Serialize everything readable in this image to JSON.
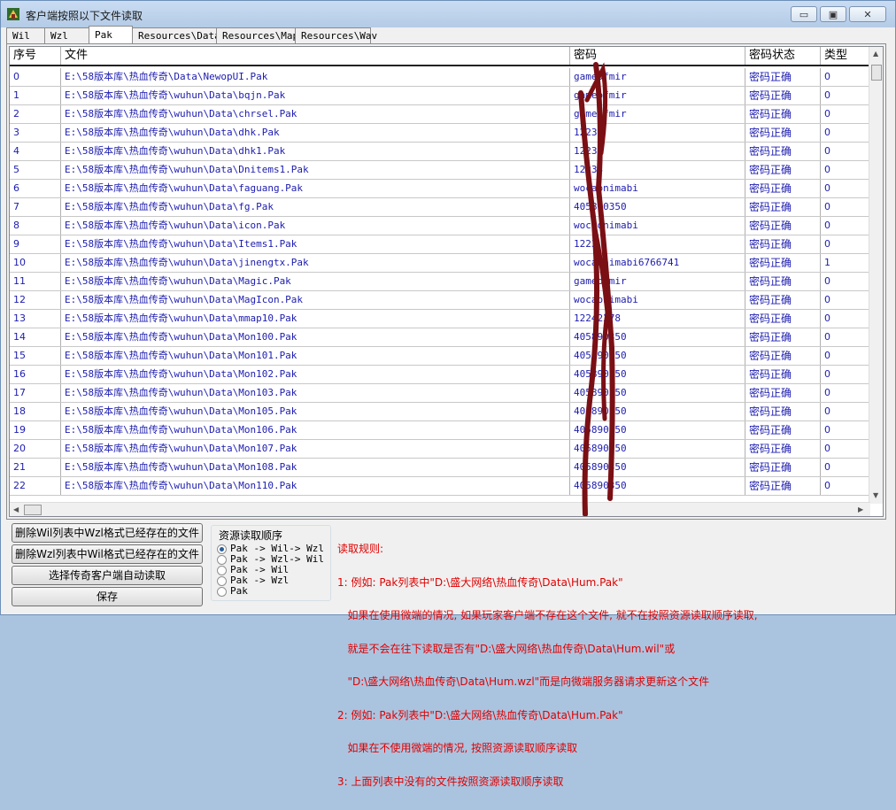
{
  "window": {
    "title": "客户端按照以下文件读取",
    "minimize_icon": "minimize-icon",
    "maximize_icon": "maximize-icon",
    "close_icon": "close-icon"
  },
  "tabs": [
    "Wil",
    "Wzl",
    "Pak",
    "Resources\\Data",
    "Resources\\Map",
    "Resources\\Wav"
  ],
  "active_tab": "Pak",
  "table": {
    "headers": [
      "序号",
      "文件",
      "密码",
      "密码状态",
      "类型"
    ],
    "rows": [
      [
        "0",
        "E:\\58版本库\\热血传奇\\Data\\NewopUI.Pak",
        "gameofmir",
        "密码正确",
        "0"
      ],
      [
        "1",
        "E:\\58版本库\\热血传奇\\wuhun\\Data\\bqjn.Pak",
        "gameofmir",
        "密码正确",
        "0"
      ],
      [
        "2",
        "E:\\58版本库\\热血传奇\\wuhun\\Data\\chrsel.Pak",
        "gameofmir",
        "密码正确",
        "0"
      ],
      [
        "3",
        "E:\\58版本库\\热血传奇\\wuhun\\Data\\dhk.Pak",
        "1223",
        "密码正确",
        "0"
      ],
      [
        "4",
        "E:\\58版本库\\热血传奇\\wuhun\\Data\\dhk1.Pak",
        "1223",
        "密码正确",
        "0"
      ],
      [
        "5",
        "E:\\58版本库\\热血传奇\\wuhun\\Data\\Dnitems1.Pak",
        "12233",
        "密码正确",
        "0"
      ],
      [
        "6",
        "E:\\58版本库\\热血传奇\\wuhun\\Data\\faguang.Pak",
        "wocaonimabi",
        "密码正确",
        "0"
      ],
      [
        "7",
        "E:\\58版本库\\热血传奇\\wuhun\\Data\\fg.Pak",
        "405890350",
        "密码正确",
        "0"
      ],
      [
        "8",
        "E:\\58版本库\\热血传奇\\wuhun\\Data\\icon.Pak",
        "wocaonimabi",
        "密码正确",
        "0"
      ],
      [
        "9",
        "E:\\58版本库\\热血传奇\\wuhun\\Data\\Items1.Pak",
        "1223",
        "密码正确",
        "0"
      ],
      [
        "10",
        "E:\\58版本库\\热血传奇\\wuhun\\Data\\jinengtx.Pak",
        "wocaonimabi6766741",
        "密码正确",
        "1"
      ],
      [
        "11",
        "E:\\58版本库\\热血传奇\\wuhun\\Data\\Magic.Pak",
        "gameofmir",
        "密码正确",
        "0"
      ],
      [
        "12",
        "E:\\58版本库\\热血传奇\\wuhun\\Data\\MagIcon.Pak",
        "wocaonimabi",
        "密码正确",
        "0"
      ],
      [
        "13",
        "E:\\58版本库\\热血传奇\\wuhun\\Data\\mmap10.Pak",
        "12242278",
        "密码正确",
        "0"
      ],
      [
        "14",
        "E:\\58版本库\\热血传奇\\wuhun\\Data\\Mon100.Pak",
        "405890350",
        "密码正确",
        "0"
      ],
      [
        "15",
        "E:\\58版本库\\热血传奇\\wuhun\\Data\\Mon101.Pak",
        "405890350",
        "密码正确",
        "0"
      ],
      [
        "16",
        "E:\\58版本库\\热血传奇\\wuhun\\Data\\Mon102.Pak",
        "405890350",
        "密码正确",
        "0"
      ],
      [
        "17",
        "E:\\58版本库\\热血传奇\\wuhun\\Data\\Mon103.Pak",
        "405890350",
        "密码正确",
        "0"
      ],
      [
        "18",
        "E:\\58版本库\\热血传奇\\wuhun\\Data\\Mon105.Pak",
        "405890350",
        "密码正确",
        "0"
      ],
      [
        "19",
        "E:\\58版本库\\热血传奇\\wuhun\\Data\\Mon106.Pak",
        "405890350",
        "密码正确",
        "0"
      ],
      [
        "20",
        "E:\\58版本库\\热血传奇\\wuhun\\Data\\Mon107.Pak",
        "405890350",
        "密码正确",
        "0"
      ],
      [
        "21",
        "E:\\58版本库\\热血传奇\\wuhun\\Data\\Mon108.Pak",
        "405890350",
        "密码正确",
        "0"
      ],
      [
        "22",
        "E:\\58版本库\\热血传奇\\wuhun\\Data\\Mon110.Pak",
        "405890350",
        "密码正确",
        "0"
      ]
    ]
  },
  "buttons": {
    "delete_wil": "删除Wil列表中Wzl格式已经存在的文件",
    "delete_wzl": "删除Wzl列表中Wil格式已经存在的文件",
    "auto_read": "选择传奇客户端自动读取",
    "save": "保存"
  },
  "resource_order": {
    "title": "资源读取顺序",
    "options": [
      "Pak -> Wil-> Wzl",
      "Pak -> Wzl-> Wil",
      "Pak -> Wil",
      "Pak -> Wzl",
      "Pak"
    ],
    "selected_index": 0
  },
  "rules": {
    "title": "读取规则:",
    "lines": [
      "1: 例如: Pak列表中\"D:\\盛大网络\\热血传奇\\Data\\Hum.Pak\"",
      "   如果在使用微端的情况, 如果玩家客户端不存在这个文件, 就不在按照资源读取顺序读取,",
      "   就是不会在往下读取是否有\"D:\\盛大网络\\热血传奇\\Data\\Hum.wil\"或",
      "   \"D:\\盛大网络\\热血传奇\\Data\\Hum.wzl\"而是向微端服务器请求更新这个文件",
      "2: 例如: Pak列表中\"D:\\盛大网络\\热血传奇\\Data\\Hum.Pak\"",
      "   如果在不使用微端的情况, 按照资源读取顺序读取",
      "3: 上面列表中没有的文件按照资源读取顺序读取"
    ]
  },
  "colors": {
    "link_blue": "#1c1cb0",
    "rule_red": "#e00000",
    "scrawl": "#7a0f14"
  }
}
